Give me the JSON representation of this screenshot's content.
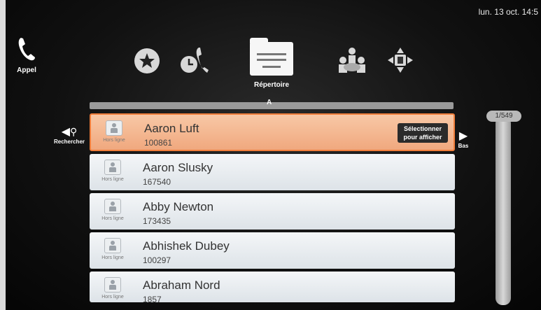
{
  "datetime": "lun. 13 oct. 14:5",
  "nav": {
    "call_label": "Appel",
    "directory_label": "Répertoire"
  },
  "list": {
    "alpha_marker": "A",
    "search_label": "Rechercher",
    "down_label": "Bas",
    "page_indicator": "1/549",
    "select_button_label": "Sélectionner pour afficher",
    "contacts": [
      {
        "name": "Aaron Luft",
        "number": "100861",
        "status": "Hors ligne"
      },
      {
        "name": "Aaron Slusky",
        "number": "167540",
        "status": "Hors ligne"
      },
      {
        "name": "Abby Newton",
        "number": "173435",
        "status": "Hors ligne"
      },
      {
        "name": "Abhishek Dubey",
        "number": "100297",
        "status": "Hors ligne"
      },
      {
        "name": "Abraham Nord",
        "number": "1857",
        "status": "Hors ligne"
      }
    ]
  },
  "colors": {
    "selected_bg": "#f0a87e",
    "selected_border": "#f07d3a",
    "row_bg": "#e6eaee",
    "background": "#111111"
  }
}
